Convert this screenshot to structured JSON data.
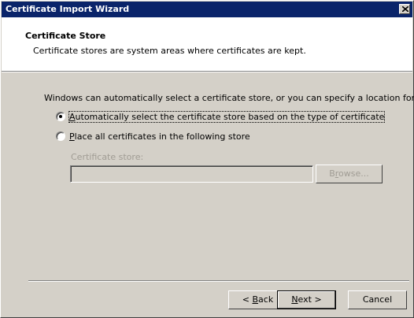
{
  "window": {
    "title": "Certificate Import Wizard",
    "close_icon": "close-icon"
  },
  "header": {
    "title": "Certificate Store",
    "subtitle": "Certificate stores are system areas where certificates are kept."
  },
  "body": {
    "intro": "Windows can automatically select a certificate store, or you can specify a location for",
    "options": [
      {
        "prefix": "",
        "accel": "A",
        "rest": "utomatically select the certificate store based on the type of certificate",
        "selected": true
      },
      {
        "prefix": "",
        "accel": "P",
        "rest": "lace all certificates in the following store",
        "selected": false
      }
    ],
    "store": {
      "label": "Certificate store:",
      "value": "",
      "browse_prefix": "B",
      "browse_accel": "r",
      "browse_rest": "owse..."
    }
  },
  "footer": {
    "back": {
      "prefix": "< ",
      "accel": "B",
      "rest": "ack"
    },
    "next": {
      "prefix": "",
      "accel": "N",
      "rest": "ext >"
    },
    "cancel": "Cancel"
  }
}
